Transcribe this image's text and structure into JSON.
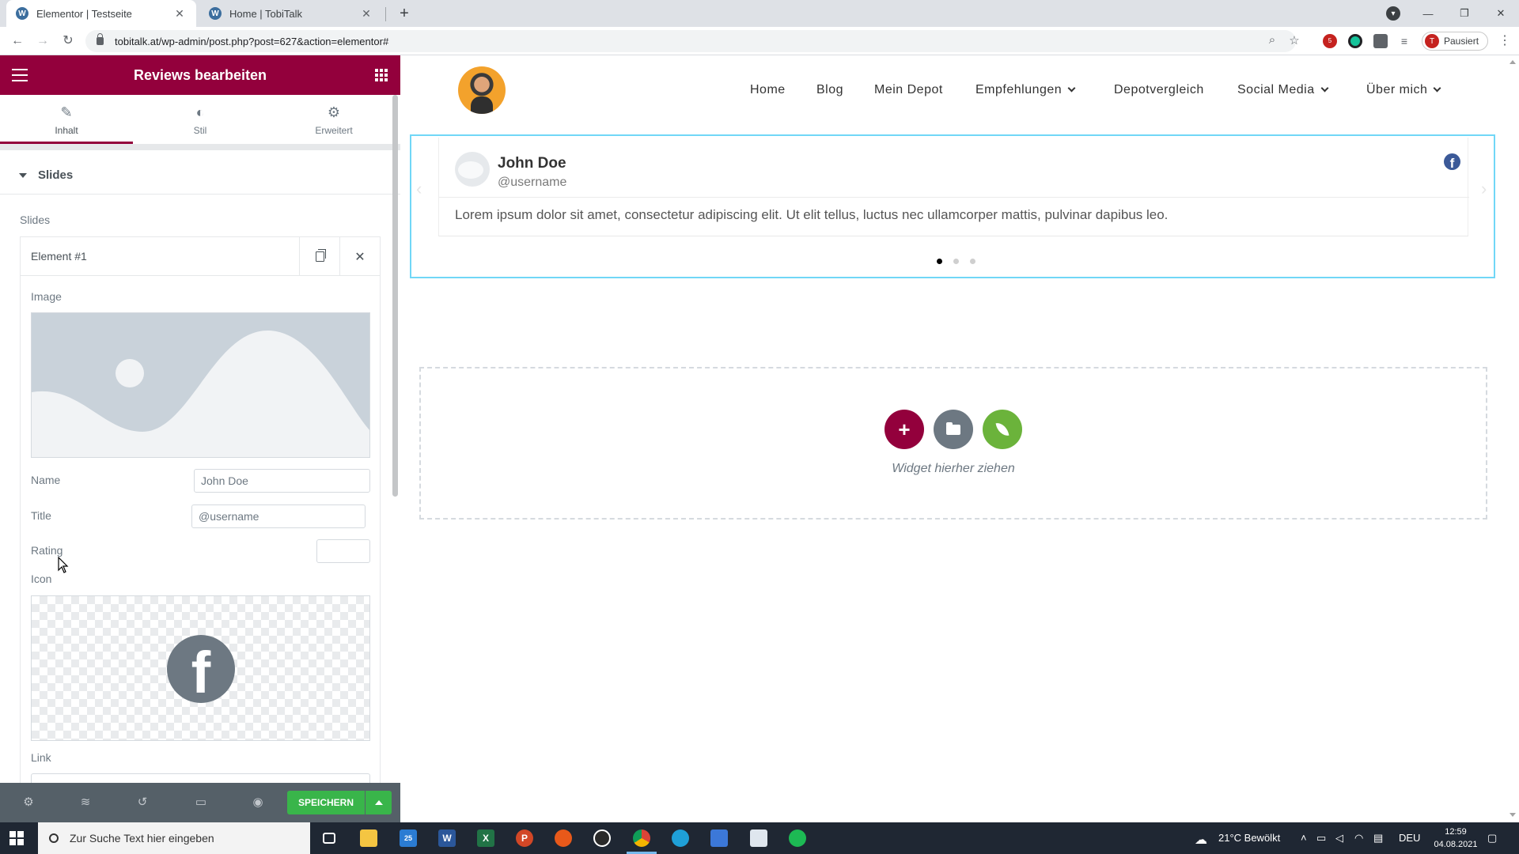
{
  "browser": {
    "tabs": [
      {
        "title": "Elementor | Testseite",
        "active": true
      },
      {
        "title": "Home | TobiTalk",
        "active": false
      }
    ],
    "url": "tobitalk.at/wp-admin/post.php?post=627&action=elementor#",
    "profile_status": "Pausiert",
    "profile_initial": "T",
    "ext_badge": "5"
  },
  "panel": {
    "title": "Reviews bearbeiten",
    "tabs": [
      {
        "label": "Inhalt",
        "icon": "pencil-icon"
      },
      {
        "label": "Stil",
        "icon": "half-circle-icon"
      },
      {
        "label": "Erweitert",
        "icon": "gear-icon"
      }
    ],
    "section_title": "Slides",
    "slides_label": "Slides",
    "element_title": "Element #1",
    "fields": {
      "image_label": "Image",
      "name_label": "Name",
      "name_value": "John Doe",
      "title_label": "Title",
      "title_value": "@username",
      "rating_label": "Rating",
      "rating_value": "",
      "icon_label": "Icon",
      "link_label": "Link"
    },
    "footer": {
      "save_label": "SPEICHERN"
    }
  },
  "site": {
    "nav": [
      {
        "label": "Home",
        "dropdown": false
      },
      {
        "label": "Blog",
        "dropdown": false
      },
      {
        "label": "Mein Depot",
        "dropdown": false
      },
      {
        "label": "Empfehlungen",
        "dropdown": true
      },
      {
        "label": "Depotvergleich",
        "dropdown": false
      },
      {
        "label": "Social Media",
        "dropdown": true
      },
      {
        "label": "Über mich",
        "dropdown": true
      }
    ],
    "review": {
      "name": "John Doe",
      "title": "@username",
      "text": "Lorem ipsum dolor sit amet, consectetur adipiscing elit. Ut elit tellus, luctus nec ullamcorper mattis, pulvinar dapibus leo.",
      "slide_count": 3,
      "active_slide": 1
    },
    "dropzone_text": "Widget hierher ziehen"
  },
  "taskbar": {
    "search_placeholder": "Zur Suche Text hier eingeben",
    "mail_badge": "25",
    "weather": "21°C  Bewölkt",
    "language": "DEU",
    "time": "12:59",
    "date": "04.08.2021"
  },
  "colors": {
    "elementor_brand": "#93003c",
    "save_green": "#39b54a",
    "selected_outline": "#71d7f7",
    "facebook_blue": "#3b5998"
  }
}
